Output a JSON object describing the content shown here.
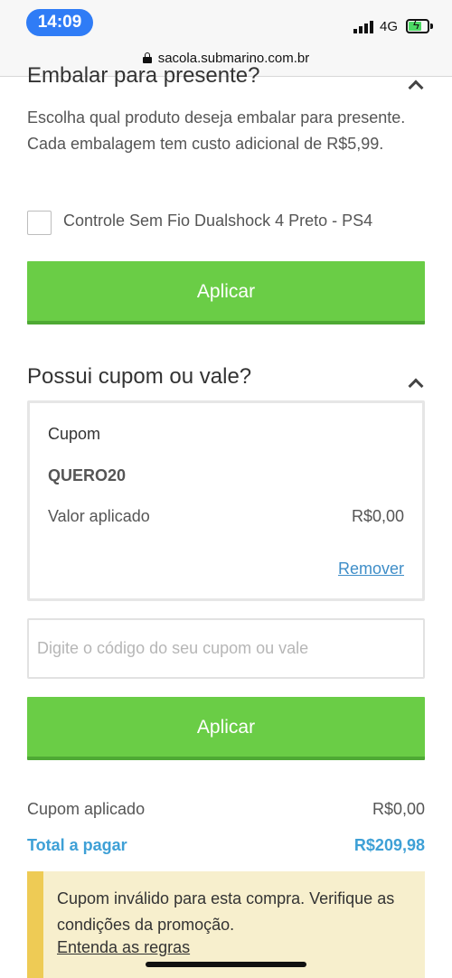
{
  "status_bar": {
    "time": "14:09",
    "network": "4G",
    "battery_level": 0.6,
    "icons": [
      "signal-icon",
      "battery-charging-icon"
    ]
  },
  "browser": {
    "url": "sacola.submarino.com.br",
    "icon": "lock-icon"
  },
  "gift_section": {
    "title": "Embalar para presente?",
    "description": "Escolha qual produto deseja embalar para presente. Cada embalagem tem custo adicional de R$5,99.",
    "product_label": "Controle Sem Fio Dualshock 4 Preto - PS4",
    "product_checked": false,
    "apply_label": "Aplicar"
  },
  "coupon_section": {
    "title": "Possui cupom ou vale?",
    "box": {
      "label": "Cupom",
      "code": "QUERO20",
      "applied_label": "Valor aplicado",
      "applied_value": "R$0,00",
      "remove_label": "Remover"
    },
    "input_placeholder": "Digite o código do seu cupom ou vale",
    "input_value": "",
    "apply_label": "Aplicar"
  },
  "summary": {
    "coupon_label": "Cupom aplicado",
    "coupon_value": "R$0,00",
    "total_label": "Total a pagar",
    "total_value": "R$209,98"
  },
  "alert": {
    "message": "Cupom inválido para esta compra. Verifique as condições da promoção.",
    "link_label": "Entenda as regras"
  },
  "colors": {
    "accent_green": "#6acd46",
    "link_blue": "#3f8ec8",
    "total_blue": "#3ea0d6",
    "alert_bg": "#f7efcd",
    "alert_border": "#eecb55",
    "time_pill": "#2f7cf6"
  }
}
